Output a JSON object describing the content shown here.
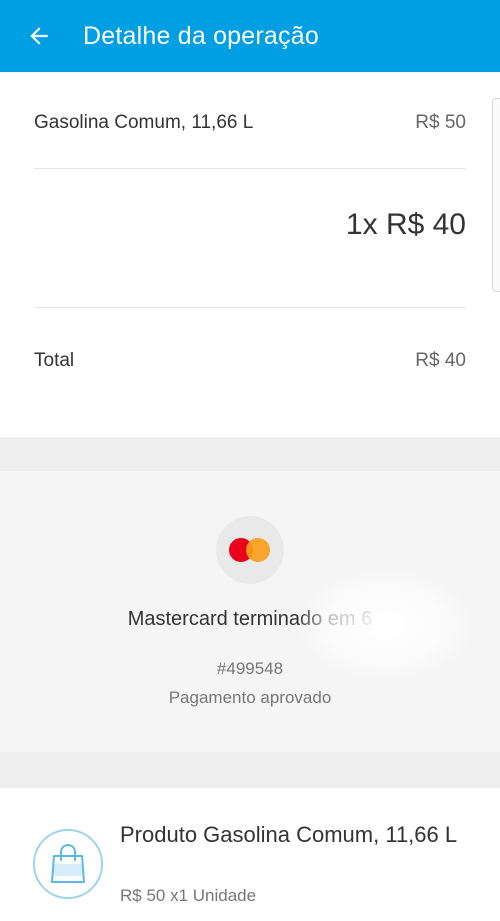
{
  "header": {
    "title": "Detalhe da operação",
    "background_color": "#009ee3",
    "back_icon": "arrow-left-icon"
  },
  "summary": {
    "item_label": "Gasolina Comum, 11,66 L",
    "item_amount": "R$ 50",
    "installments": "1x R$ 40",
    "total_label": "Total",
    "total_amount": "R$ 40"
  },
  "payment": {
    "card_brand_icon": "mastercard-logo-icon",
    "card_description": "Mastercard terminado em 6",
    "operation_id": "#499548",
    "status": "Pagamento aprovado"
  },
  "product": {
    "icon": "shopping-bag-icon",
    "name": "Produto Gasolina Comum, 11,66 L",
    "detail": "R$ 50 x1 Unidade"
  }
}
